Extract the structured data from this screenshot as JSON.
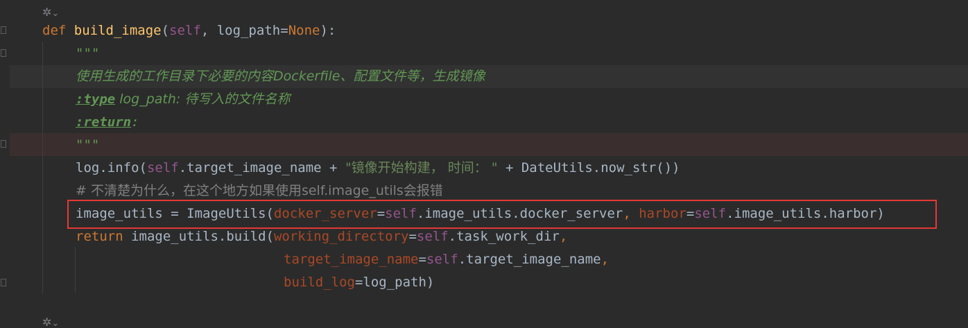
{
  "colors": {
    "background": "#2b2b2b",
    "keyword": "#cc7832",
    "function": "#ffc66d",
    "self": "#94558d",
    "param": "#aa4926",
    "string": "#6a8759",
    "docstring": "#629755",
    "comment": "#808080",
    "highlight_box": "#e53935"
  },
  "icons": {
    "top": "inlay-hint-icon",
    "bottom": "inlay-hint-icon"
  },
  "code": {
    "def": "def",
    "fname": "build_image",
    "sig_open": "(",
    "self": "self",
    "sig_rest": ", log_path=",
    "none": "None",
    "sig_close": "):",
    "doc_open": "\"\"\"",
    "doc_desc": "使用生成的工作目录下必要的内容Dockerfile、配置文件等，生成镜像",
    "doc_type_tag": ":type",
    "doc_type_rest": " log_path: 待写入的文件名称",
    "doc_return_tag": ":return",
    "doc_return_rest": ":",
    "doc_close": "\"\"\"",
    "log_start": "log.info(",
    "log_self": "self",
    "log_mid": ".target_image_name + ",
    "log_str": "\"镜像开始构建， 时间： \"",
    "log_end": " + DateUtils.now_str())",
    "comment": "# 不清楚为什么，在这个地方如果使用self.image_utils会报错",
    "iu_start": "image_utils = ImageUtils(",
    "iu_p1": "docker_server",
    "iu_eq1": "=",
    "iu_self1": "self",
    "iu_v1": ".image_utils.docker_server",
    "iu_comma": ", ",
    "iu_p2": "harbor",
    "iu_eq2": "=",
    "iu_self2": "self",
    "iu_v2": ".image_utils.harbor)",
    "ret_kw": "return",
    "ret_call": " image_utils.build(",
    "ret_p1": "working_directory",
    "ret_eq1": "=",
    "ret_self1": "self",
    "ret_v1": ".task_work_dir",
    "ret_c1": ",",
    "ret_p2": "target_image_name",
    "ret_eq2": "=",
    "ret_self2": "self",
    "ret_v2": ".target_image_name",
    "ret_c2": ",",
    "ret_p3": "build_log",
    "ret_v3": "=log_path)"
  }
}
